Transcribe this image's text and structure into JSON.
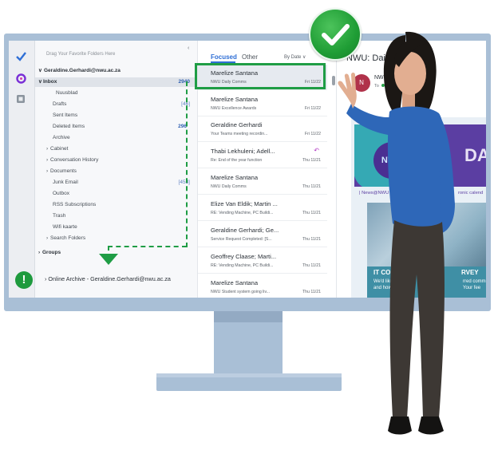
{
  "folders": {
    "favorites_hint": "Drag Your Favorite Folders Here",
    "account": "Geraldine.Gerhardi@nwu.ac.za",
    "items": [
      {
        "label": "Inbox",
        "count": "2940"
      },
      {
        "label": "Nuusblad",
        "count": ""
      },
      {
        "label": "Drafts",
        "count": "[46]"
      },
      {
        "label": "Sent Items",
        "count": ""
      },
      {
        "label": "Deleted Items",
        "count": "296"
      },
      {
        "label": "Archive",
        "count": ""
      },
      {
        "label": "Cabinet",
        "count": ""
      },
      {
        "label": "Conversation History",
        "count": ""
      },
      {
        "label": "Documents",
        "count": ""
      },
      {
        "label": "Junk Email",
        "count": "[458]"
      },
      {
        "label": "Outbox",
        "count": ""
      },
      {
        "label": "RSS Subscriptions",
        "count": ""
      },
      {
        "label": "Trash",
        "count": ""
      },
      {
        "label": "Wifi kaarte",
        "count": ""
      },
      {
        "label": "Search Folders",
        "count": ""
      },
      {
        "label": "Groups",
        "count": ""
      }
    ],
    "online_archive": "Online Archive - Geraldine.Gerhardi@nwu.ac.za",
    "warning_glyph": "!"
  },
  "messages": {
    "tab_focused": "Focused",
    "tab_other": "Other",
    "sort": "By Date ∨",
    "list": [
      {
        "sender": "Marelize Santana",
        "subject": "NWU Daily Comms",
        "date": "Fri 11/22"
      },
      {
        "sender": "Marelize Santana",
        "subject": "NWU Excellence Awards",
        "date": "Fri 11/22"
      },
      {
        "sender": "Geraldine Gerhardi",
        "subject": "Your Teams meeting recordin...",
        "date": "Fri 11/22"
      },
      {
        "sender": "Thabi Lekhuleni; Adell...",
        "subject": "Re: End of the year function",
        "date": "Thu 11/21"
      },
      {
        "sender": "Marelize Santana",
        "subject": "NWU Daily Comms",
        "date": "Thu 11/21"
      },
      {
        "sender": "Elize Van Eldik; Martin ...",
        "subject": "RE: Vending Machine, PC Buildi...",
        "date": "Thu 11/21"
      },
      {
        "sender": "Geraldine Gerhardi; Ge...",
        "subject": "Service Request Completed: [S...",
        "date": "Thu 11/21"
      },
      {
        "sender": "Geoffrey Claase; Marti...",
        "subject": "RE: Vending Machine, PC Buildi...",
        "date": "Thu 11/21"
      },
      {
        "sender": "Marelize Santana",
        "subject": "NWU Student system going liv...",
        "date": "Thu 11/21"
      }
    ]
  },
  "reading": {
    "title": "NWU: Daily Co",
    "avatar": "N",
    "from": "NWU",
    "to_label": "To",
    "to_value": "Ma",
    "banner_logo": "NWU",
    "banner_word": "DA",
    "news_left": "| News@NWU |",
    "news_right": "ronic calend",
    "survey_heading": "IT COMM",
    "survey_line1": "We'd like to",
    "survey_line2": "and how",
    "survey_heading_right": "RVEY",
    "survey_right1": "rred comm",
    "survey_right2": "Your fee"
  },
  "colors": {
    "monitor": "#a9bfd6",
    "accent_blue": "#2f6fd6",
    "highlight_green": "#1f9d45",
    "banner_purple": "#5b3ea2"
  }
}
